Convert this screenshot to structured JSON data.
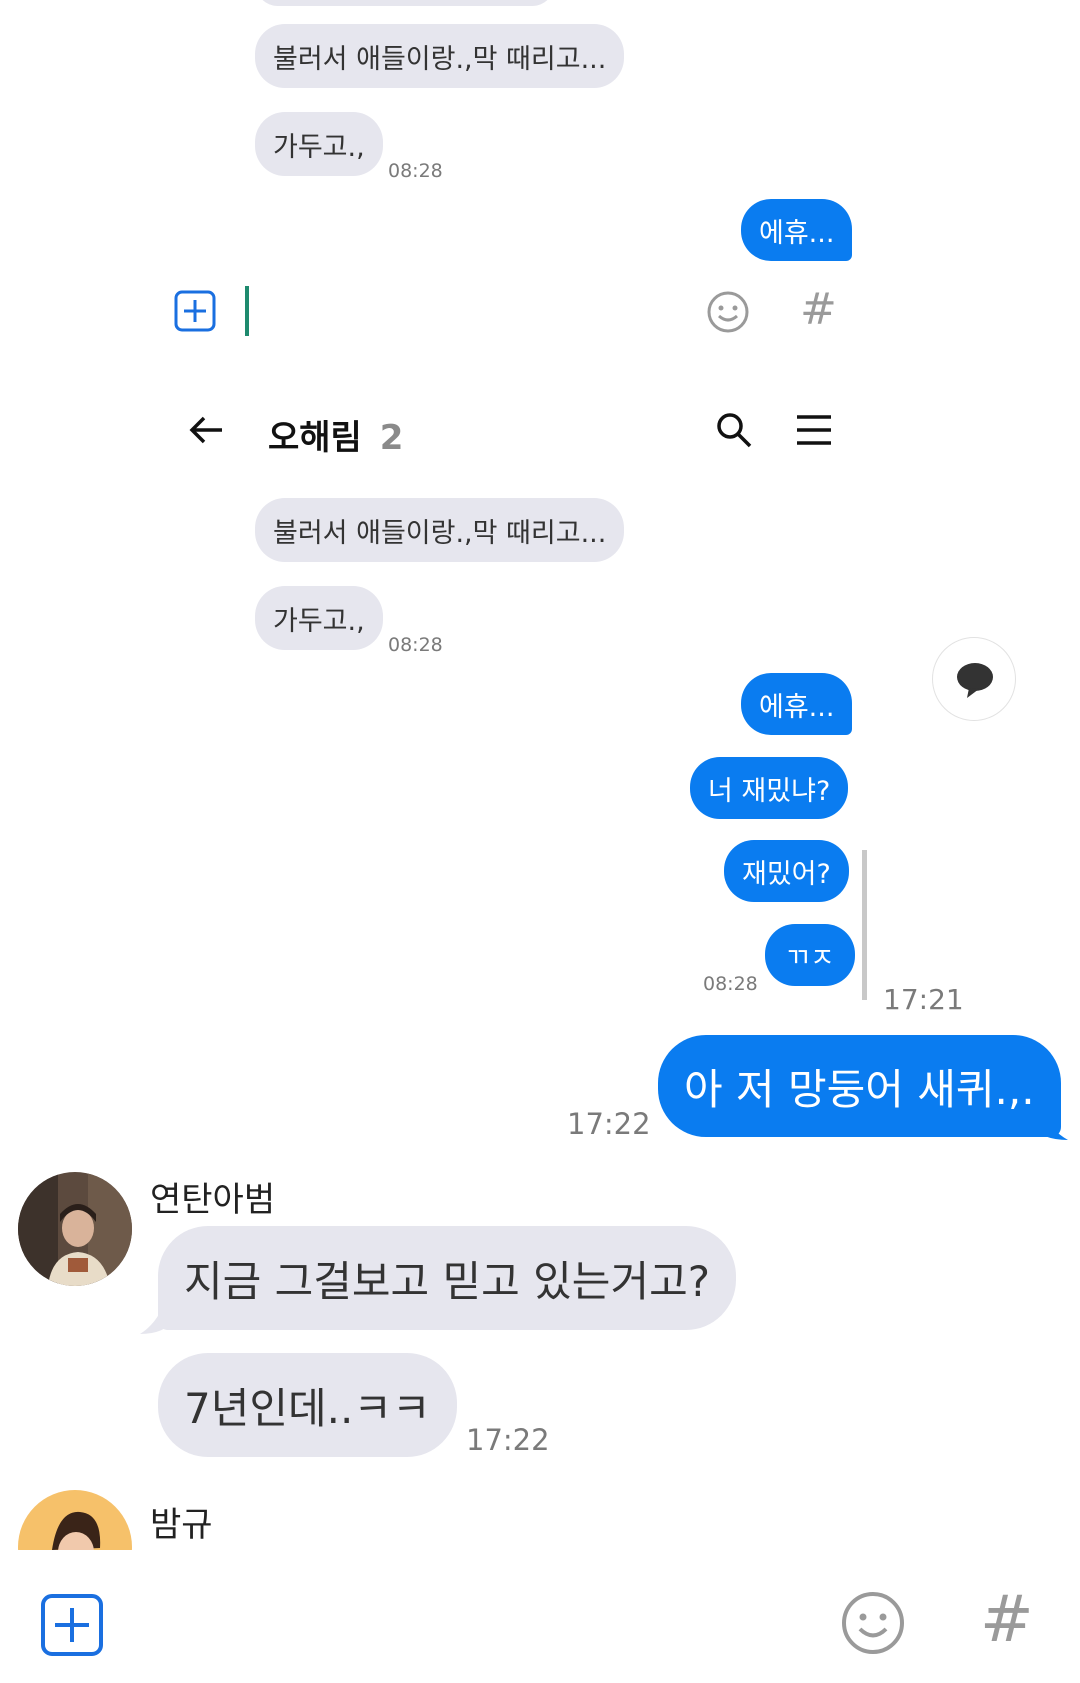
{
  "screenshot1": {
    "messages": [
      {
        "text": "불러서 애들이랑.,막 때리고...",
        "side": "in"
      },
      {
        "text": "가두고.,",
        "side": "in",
        "time": "08:28"
      },
      {
        "text": "에휴...",
        "side": "out"
      }
    ],
    "composer": {
      "plus_icon": "plus-icon",
      "emoji_icon": "emoji-icon",
      "hash_label": "#"
    }
  },
  "screenshot2": {
    "header": {
      "title": "오해림",
      "count": "2",
      "back_icon": "back-arrow-icon",
      "search_icon": "search-icon",
      "menu_icon": "menu-icon"
    },
    "messages": [
      {
        "text": "불러서 애들이랑.,막 때리고...",
        "side": "in"
      },
      {
        "text": "가두고.,",
        "side": "in",
        "time": "08:28"
      },
      {
        "text": "에휴...",
        "side": "out"
      },
      {
        "text": "너 재밌냐?",
        "side": "out"
      },
      {
        "text": "재밌어?",
        "side": "out"
      },
      {
        "text": "ㄲㅈ",
        "side": "out",
        "time": "08:28"
      }
    ],
    "chat_bubble_icon": "chat-bubble-icon"
  },
  "outer_time_1721": "17:21",
  "chat": {
    "messages": [
      {
        "text": "아 저 망둥어 새퀴.,.",
        "side": "out",
        "time": "17:22"
      },
      {
        "sender": "연탄아범",
        "text": "지금 그걸보고 믿고 있는거고?",
        "side": "in"
      },
      {
        "sender": "연탄아범",
        "text": "7년인데..ㅋㅋ",
        "side": "in",
        "time": "17:22"
      },
      {
        "sender": "밤규",
        "side": "in"
      }
    ]
  },
  "composer": {
    "plus_icon": "plus-icon",
    "emoji_icon": "emoji-icon",
    "hash_label": "#"
  },
  "colors": {
    "accent": "#0a7cf0",
    "incoming": "#e6e6ee"
  }
}
